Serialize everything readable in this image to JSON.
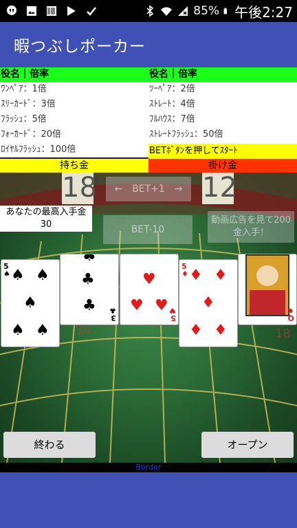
{
  "status_bar": {
    "battery": "85%",
    "time": "午後2:27",
    "icons": [
      "hangouts-icon",
      "image-icon",
      "barcode-icon",
      "play-store-icon",
      "check-icon",
      "bluetooth-icon",
      "wifi-icon",
      "signal-icon",
      "battery-icon"
    ]
  },
  "app": {
    "title": "暇つぶしポーカー"
  },
  "rules": {
    "header_left": "役名｜倍率",
    "header_right": "役名｜倍率",
    "left": [
      "ﾜﾝﾍﾟｱ：1倍",
      "ｽﾘｰｶｰﾄﾞ：3倍",
      "ﾌﾗｯｼｭ：5倍",
      "ﾌｫｰｶｰﾄﾞ：20倍",
      "ﾛｲﾔﾙﾌﾗｯｼｭ：100倍"
    ],
    "right": [
      "ﾂｰﾍﾟｱ：2倍",
      "ｽﾄﾚｰﾄ：4倍",
      "ﾌﾙﾊｳｽ：7倍",
      "ｽﾄﾚｰﾄﾌﾗｯｼｭ：50倍"
    ],
    "hint": "BETﾎﾞﾀﾝを押してｽﾀｰﾄ"
  },
  "money": {
    "label": "持ち金",
    "value": "18"
  },
  "bet": {
    "label": "掛け金",
    "value": "12"
  },
  "buttons": {
    "bet_plus": "←　BET+1　→",
    "bet_minus": "BET-10",
    "video_ad": "動画広告を見て200金入手！",
    "quit": "終わる",
    "open": "オープン"
  },
  "record": {
    "label": "あなたの最高入手金",
    "value": "30"
  },
  "cards": [
    {
      "rank": "5",
      "suit": "♠",
      "color": "#000000"
    },
    {
      "rank": "3",
      "suit": "♣",
      "color": "#000000"
    },
    {
      "rank": "5",
      "suit": "♥",
      "color": "#e21b1b"
    },
    {
      "rank": "5",
      "suit": "♦",
      "color": "#e21b1b"
    },
    {
      "rank": "Q",
      "suit": "♦",
      "color": "#e21b1b"
    }
  ],
  "footer": {
    "border_text": "Border"
  },
  "colors": {
    "app_bar": "#3f51b5",
    "rules_header": "#19ff19",
    "money_label": "#ffff00",
    "bet_label": "#ff3300",
    "felt": "#2b6b37"
  }
}
